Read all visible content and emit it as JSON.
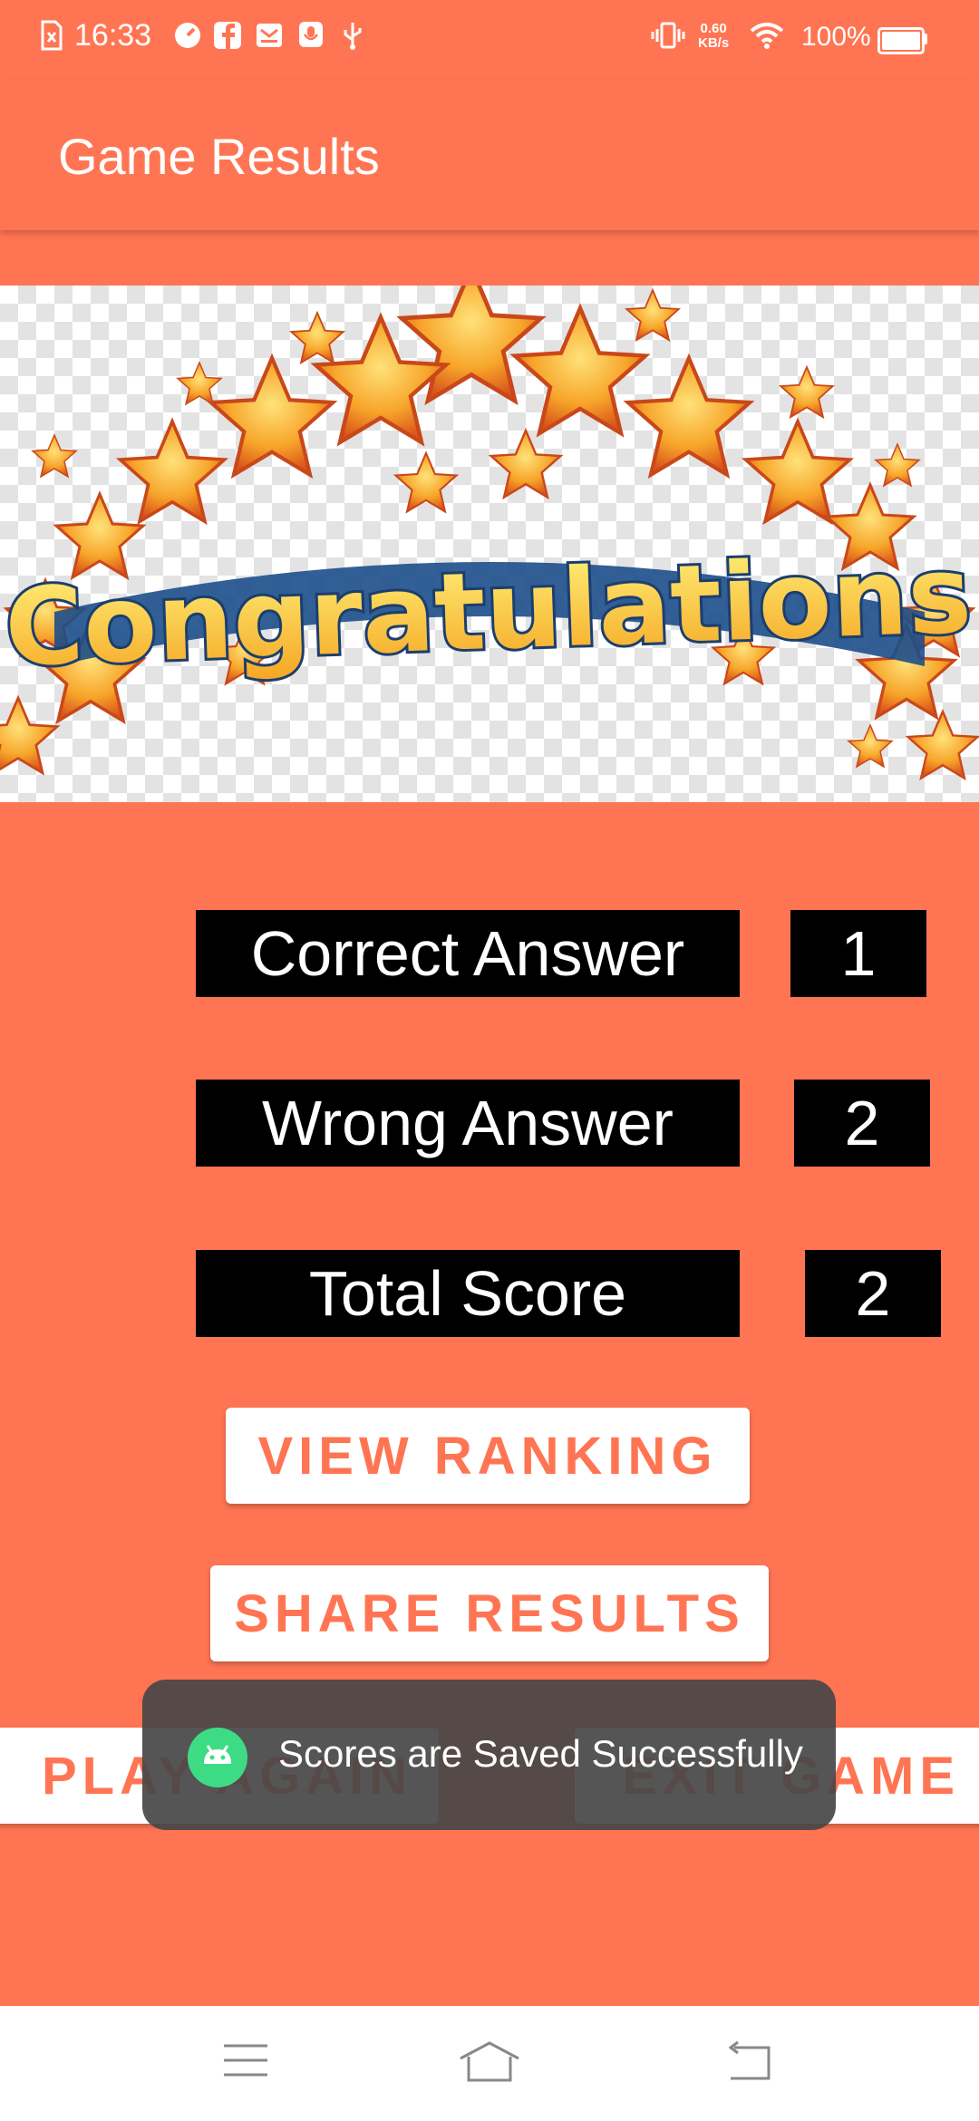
{
  "status_bar": {
    "time": "16:33",
    "net_speed_value": "0.60",
    "net_speed_unit": "KB/s",
    "battery_percent": "100%"
  },
  "app_bar": {
    "title": "Game Results"
  },
  "banner": {
    "text": "Congratulations"
  },
  "results": {
    "correct_label": "Correct Answer",
    "correct_value": "1",
    "wrong_label": "Wrong Answer",
    "wrong_value": "2",
    "total_label": "Total Score",
    "total_value": "2"
  },
  "buttons": {
    "view_ranking": "VIEW RANKING",
    "share_results": "SHARE RESULTS",
    "play_again": "PLAY AGAIN",
    "exit_game": "EXIT GAME"
  },
  "toast": {
    "message": "Scores are Saved Successfully"
  },
  "colors": {
    "accent": "#FF7553",
    "toast_bg": "#464646",
    "android_green": "#3DDC84"
  },
  "icons": [
    "sim-icon",
    "clock-app-icon",
    "facebook-icon",
    "mail-icon",
    "mic-icon",
    "usb-icon",
    "vibrate-icon",
    "wifi-icon",
    "battery-icon",
    "android-icon",
    "menu-icon",
    "home-icon",
    "back-icon"
  ]
}
